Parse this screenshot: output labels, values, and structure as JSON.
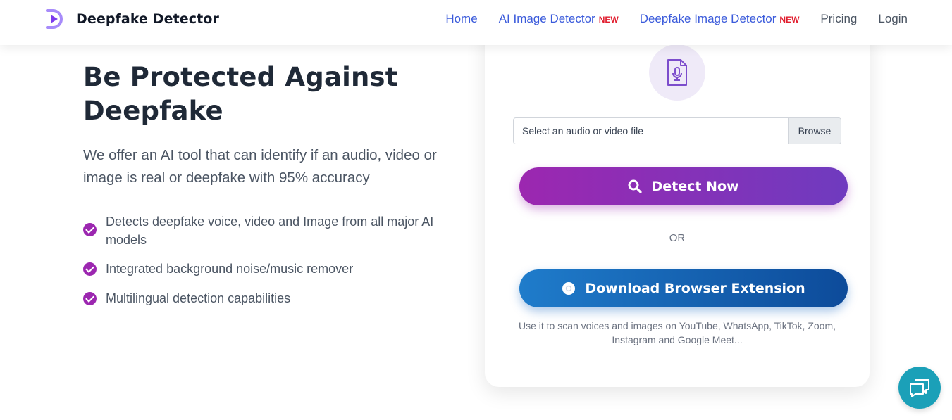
{
  "header": {
    "brand": "Deepfake Detector",
    "nav": [
      {
        "label": "Home",
        "badge": ""
      },
      {
        "label": "AI Image Detector",
        "badge": "NEW"
      },
      {
        "label": "Deepfake Image Detector",
        "badge": "NEW"
      },
      {
        "label": "Pricing",
        "badge": ""
      },
      {
        "label": "Login",
        "badge": ""
      }
    ]
  },
  "hero": {
    "title": "Be Protected Against Deepfake",
    "subtitle": "We offer an AI tool that can identify if an audio, video or image is real or deepfake with 95% accuracy",
    "features": [
      "Detects deepfake voice, video and Image from all major AI models",
      "Integrated background noise/music remover",
      "Multilingual detection capabilities"
    ]
  },
  "uploader": {
    "file_placeholder": "Select an audio or video file",
    "browse_label": "Browse",
    "detect_label": "Detect Now",
    "or_label": "OR",
    "extension_label": "Download Browser Extension",
    "note": "Use it to scan voices and images on YouTube, WhatsApp, TikTok, Zoom, Instagram and Google Meet..."
  },
  "colors": {
    "primary_purple": "#9c27b0",
    "nav_blue": "#3b5bdb",
    "new_badge": "#e11d2e",
    "extension_blue": "#1565c0",
    "chat_teal": "#1ba0b8"
  },
  "icons": [
    "logo-d-play-icon",
    "audio-file-icon",
    "search-icon",
    "chrome-icon",
    "chat-icon",
    "check-circle-icon"
  ]
}
